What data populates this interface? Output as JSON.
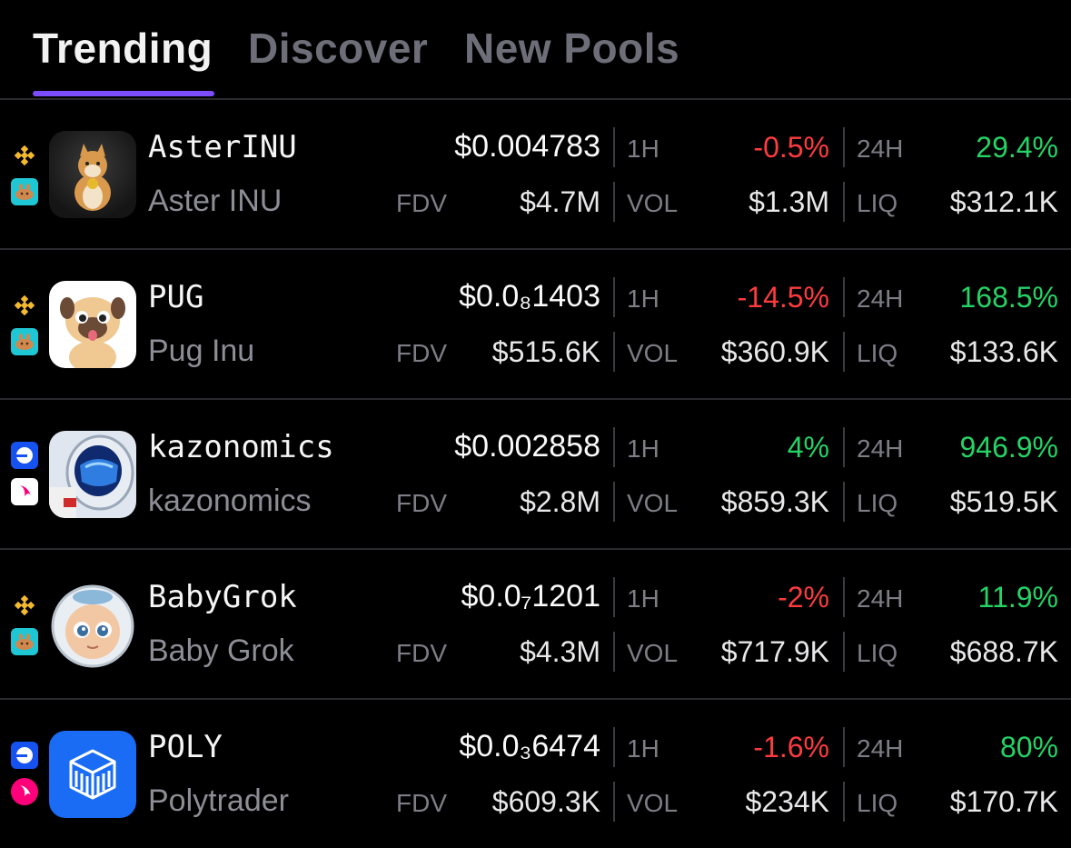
{
  "tabs": [
    {
      "label": "Trending"
    },
    {
      "label": "Discover"
    },
    {
      "label": "New Pools"
    }
  ],
  "labels": {
    "fdv": "FDV",
    "h1": "1H",
    "vol": "VOL",
    "h24": "24H",
    "liq": "LIQ"
  },
  "tokens": [
    {
      "symbol": "AsterINU",
      "name": "Aster INU",
      "price": "$0.004783",
      "fdv": "$4.7M",
      "change_1h": "-0.5%",
      "vol": "$1.3M",
      "change_24h": "29.4%",
      "liq": "$312.1K"
    },
    {
      "symbol": "PUG",
      "name": "Pug Inu",
      "price": "$0.0₈1403",
      "fdv": "$515.6K",
      "change_1h": "-14.5%",
      "vol": "$360.9K",
      "change_24h": "168.5%",
      "liq": "$133.6K"
    },
    {
      "symbol": "kazonomics",
      "name": "kazonomics",
      "price": "$0.002858",
      "fdv": "$2.8M",
      "change_1h": "4%",
      "vol": "$859.3K",
      "change_24h": "946.9%",
      "liq": "$519.5K"
    },
    {
      "symbol": "BabyGrok",
      "name": "Baby Grok",
      "price": "$0.0₇1201",
      "fdv": "$4.3M",
      "change_1h": "-2%",
      "vol": "$717.9K",
      "change_24h": "11.9%",
      "liq": "$688.7K"
    },
    {
      "symbol": "POLY",
      "name": "Polytrader",
      "price": "$0.0₃6474",
      "fdv": "$609.3K",
      "change_1h": "-1.6%",
      "vol": "$234K",
      "change_24h": "80%",
      "liq": "$170.7K"
    }
  ],
  "colors": {
    "accent": "#7b4dff",
    "negative": "#ff3b3f",
    "positive": "#25d366"
  }
}
